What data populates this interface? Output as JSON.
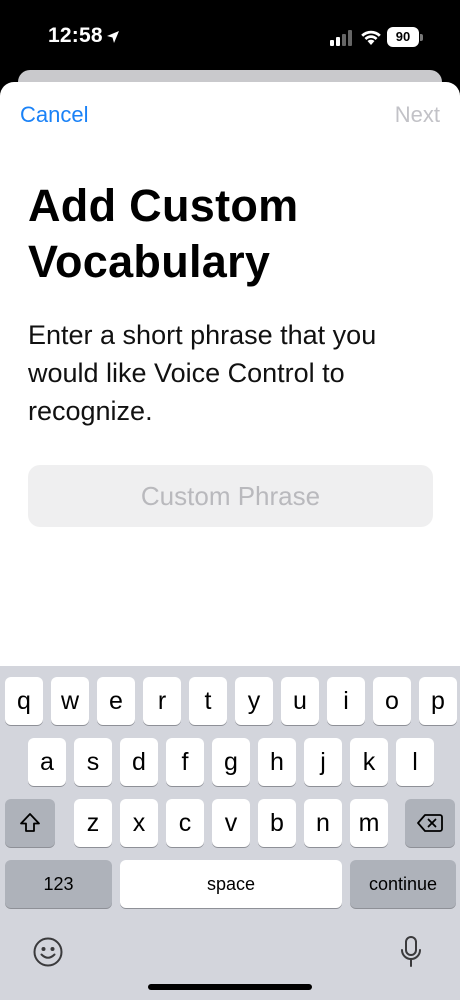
{
  "status_bar": {
    "time": "12:58",
    "battery": "90"
  },
  "nav": {
    "cancel": "Cancel",
    "next": "Next"
  },
  "page": {
    "title": "Add Custom Vocabulary",
    "description": "Enter a short phrase that you would like Voice Control to recognize.",
    "input_placeholder": "Custom Phrase",
    "input_value": ""
  },
  "keyboard": {
    "row1": [
      "q",
      "w",
      "e",
      "r",
      "t",
      "y",
      "u",
      "i",
      "o",
      "p"
    ],
    "row2": [
      "a",
      "s",
      "d",
      "f",
      "g",
      "h",
      "j",
      "k",
      "l"
    ],
    "row3": [
      "z",
      "x",
      "c",
      "v",
      "b",
      "n",
      "m"
    ],
    "numbers_label": "123",
    "space_label": "space",
    "return_label": "continue"
  },
  "icons": {
    "location": "location-arrow-icon",
    "signal": "cellular-signal-icon",
    "wifi": "wifi-icon",
    "shift": "shift-icon",
    "delete": "delete-icon",
    "emoji": "emoji-icon",
    "dictation": "microphone-icon"
  }
}
